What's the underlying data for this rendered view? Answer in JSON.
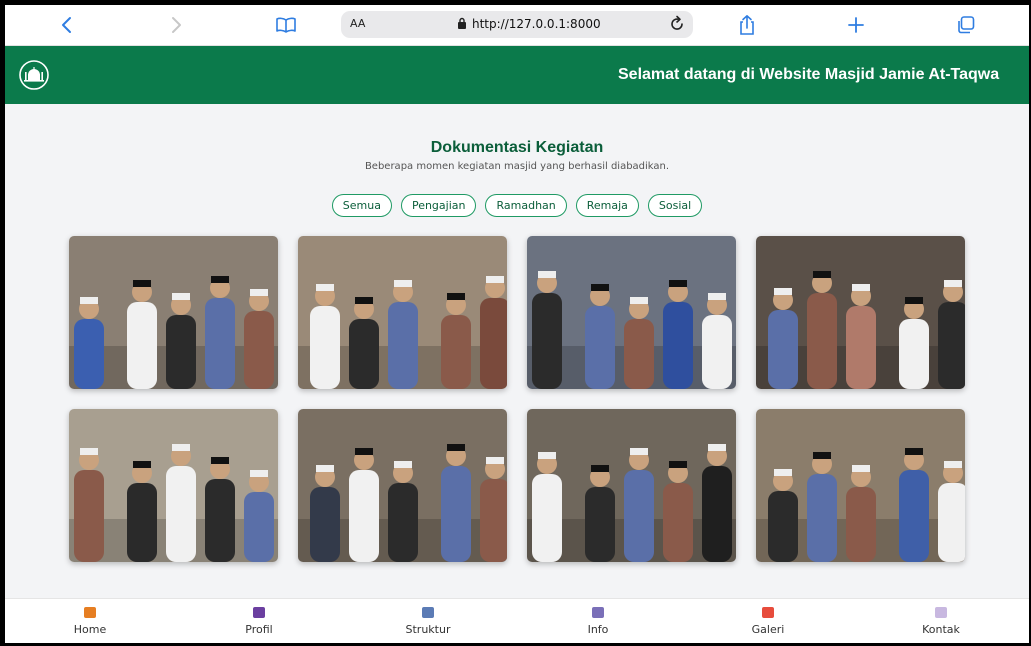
{
  "browser": {
    "text_size_label": "AA",
    "url": "http://127.0.0.1:8000"
  },
  "header": {
    "marquee": "Selamat datang di Website Masjid Jamie At-Taqwa"
  },
  "gallery": {
    "title": "Dokumentasi Kegiatan",
    "subtitle": "Beberapa momen kegiatan masjid yang berhasil diabadikan.",
    "filters": [
      "Semua",
      "Pengajian",
      "Ramadhan",
      "Remaja",
      "Sosial"
    ],
    "photos": [
      {
        "name": "photo-1",
        "bg": "#8a7f73",
        "accent": "#3b5fb0"
      },
      {
        "name": "photo-2",
        "bg": "#9a8a78",
        "accent": "#7a4a3c"
      },
      {
        "name": "photo-3",
        "bg": "#6b7280",
        "accent": "#2f4f9e"
      },
      {
        "name": "photo-4",
        "bg": "#5a5048",
        "accent": "#b07a6a"
      },
      {
        "name": "photo-5",
        "bg": "#a89f90",
        "accent": "#2a2a2a"
      },
      {
        "name": "photo-6",
        "bg": "#7a6f62",
        "accent": "#333a4a"
      },
      {
        "name": "photo-7",
        "bg": "#6f675c",
        "accent": "#1f1f1f"
      },
      {
        "name": "photo-8",
        "bg": "#8b7d6b",
        "accent": "#3f5fa8"
      }
    ]
  },
  "bottom_nav": [
    {
      "label": "Home",
      "icon": "home-icon",
      "color": "#e67e22"
    },
    {
      "label": "Profil",
      "icon": "people-icon",
      "color": "#6b3fa0"
    },
    {
      "label": "Struktur",
      "icon": "calendar-icon",
      "color": "#5b7bb5"
    },
    {
      "label": "Info",
      "icon": "info-chart-icon",
      "color": "#7a6fb8"
    },
    {
      "label": "Galeri",
      "icon": "rainbow-icon",
      "color": "#e74c3c"
    },
    {
      "label": "Kontak",
      "icon": "mail-icon",
      "color": "#c8b8e0"
    }
  ],
  "colors": {
    "brand_green": "#0b7a4b",
    "title_green": "#0b5e3a",
    "chip_border": "#1f9a64"
  }
}
